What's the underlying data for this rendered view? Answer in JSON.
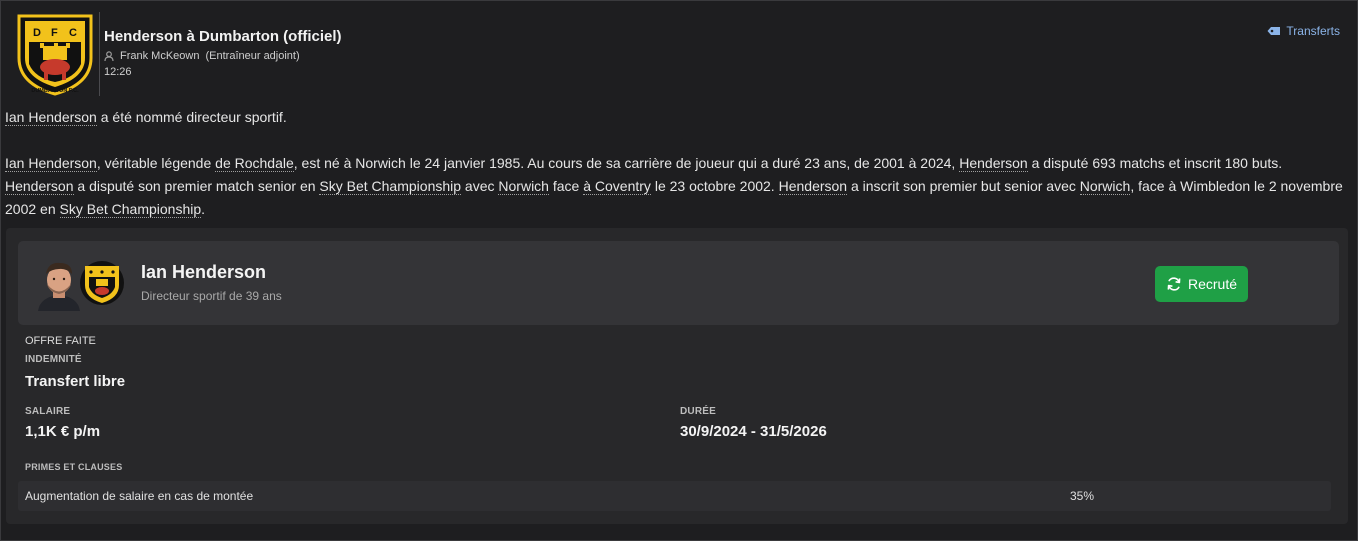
{
  "header": {
    "title": "Henderson à Dumbarton (officiel)",
    "author": "Frank McKeown",
    "author_role": "(Entraîneur adjoint)",
    "time": "12:26",
    "tag": "Transferts",
    "crest_letters": [
      "D",
      "F",
      "C"
    ],
    "crest_name": "DUMBARTON F.C."
  },
  "article": {
    "p1": {
      "s1": "Ian Henderson",
      "s2": " a été nommé directeur sportif."
    },
    "p2": {
      "s1": "Ian Henderson",
      "s2": ", véritable légende ",
      "s3": "de Rochdale",
      "s4": ", est né à Norwich le 24 janvier 1985. Au cours de sa carrière de joueur qui a duré 23 ans, de 2001 à 2024, ",
      "s5": "Henderson",
      "s6": " a disputé 693 matchs et inscrit 180 buts. ",
      "s7": "Henderson",
      "s8": " a disputé son premier match senior en ",
      "s9": "Sky Bet Championship",
      "s10": " avec ",
      "s11": "Norwich",
      "s12": " face ",
      "s13": "à Coventry",
      "s14": " le 23 octobre 2002. ",
      "s15": "Henderson",
      "s16": " a inscrit son premier but senior avec ",
      "s17": "Norwich",
      "s18": ", face à Wimbledon le 2 novembre 2002 en ",
      "s19": "Sky Bet Championship",
      "s20": "."
    }
  },
  "person": {
    "name": "Ian Henderson",
    "role": "Directeur sportif de 39 ans",
    "button": "Recruté"
  },
  "offer": {
    "status": "OFFRE FAITE",
    "fee_label": "INDEMNITÉ",
    "fee_value": "Transfert libre",
    "salary_label": "SALAIRE",
    "salary_value": "1,1K € p/m",
    "duration_label": "DURÉE",
    "duration_value": "30/9/2024 - 31/5/2026",
    "clauses_label": "PRIMES ET CLAUSES",
    "clauses": [
      {
        "text": "Augmentation de salaire en cas de montée",
        "value": "35%"
      }
    ]
  },
  "colors": {
    "background": "#1e1e20",
    "card": "#28282a",
    "person_card": "#343437",
    "button_green": "#1fa046",
    "link_blue": "#8bb4e8",
    "crest_yellow": "#f2c21b",
    "crest_black": "#111111"
  },
  "icons": {
    "author": "person-icon",
    "tag": "tag-icon",
    "button": "refresh-icon"
  }
}
